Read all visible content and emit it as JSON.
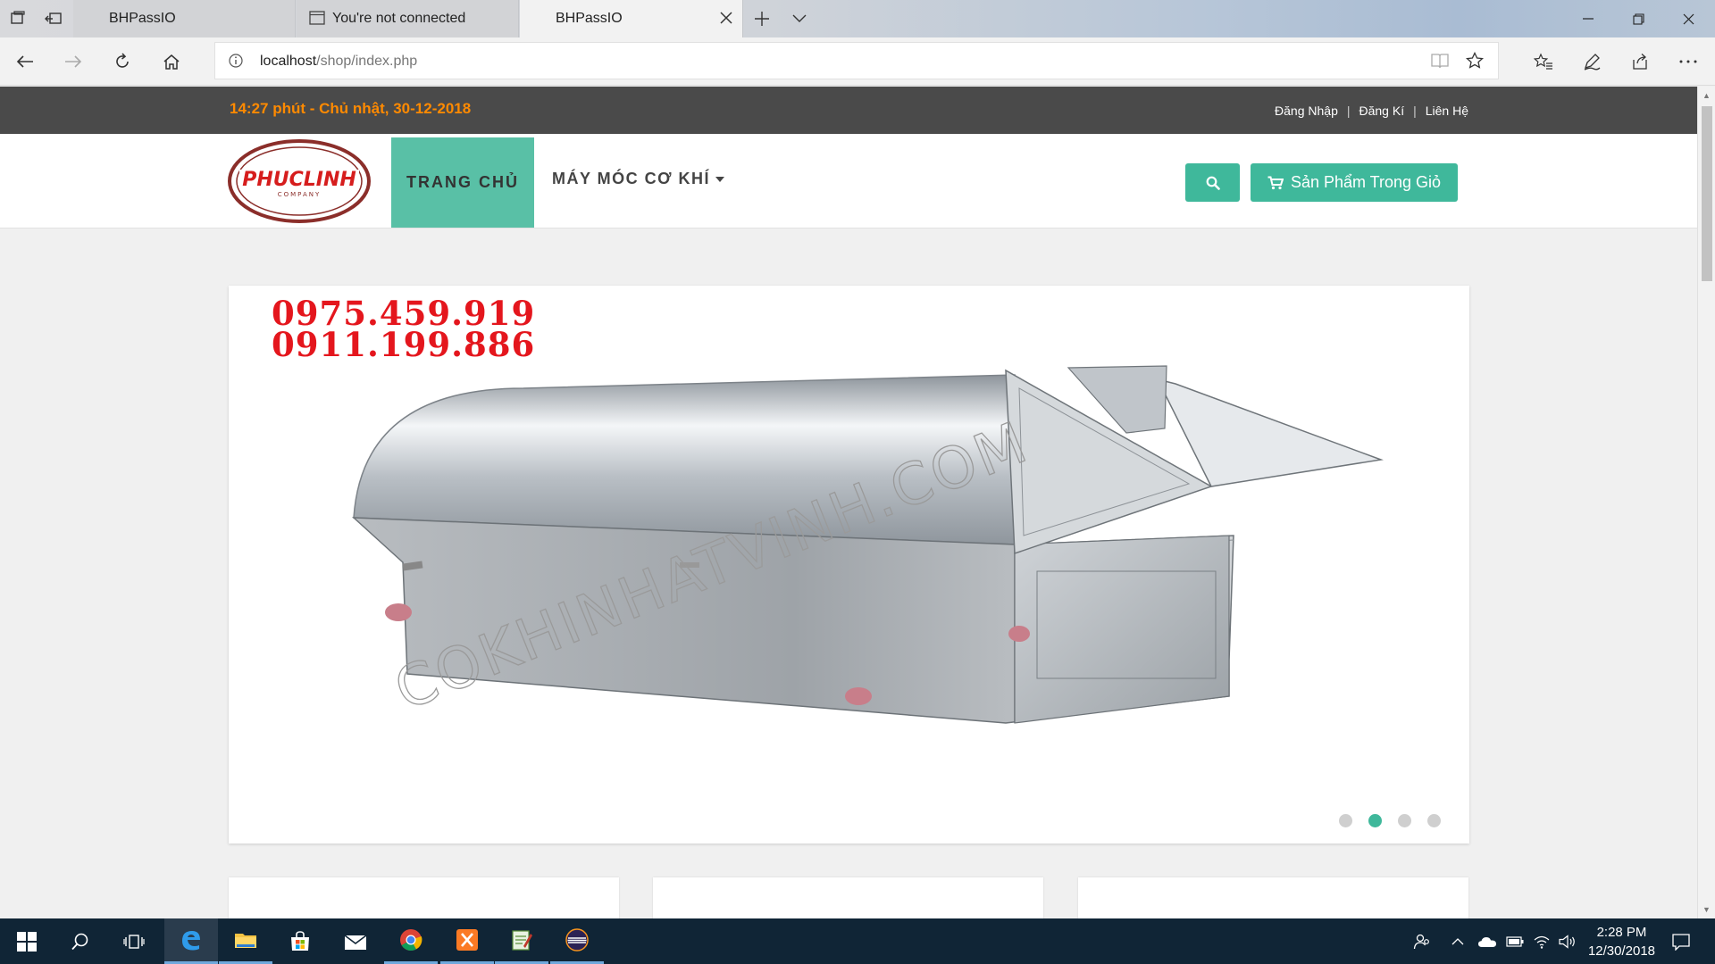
{
  "browser": {
    "tabs": [
      {
        "title": "BHPassIO",
        "active": false
      },
      {
        "title": "You're not connected",
        "active": false
      },
      {
        "title": "BHPassIO",
        "active": true
      }
    ],
    "url_host": "localhost",
    "url_path": "/shop/index.php"
  },
  "site": {
    "datetime": "14:27 phút - Chủ nhật, 30-12-2018",
    "top_links": [
      "Đăng Nhập",
      "Đăng Kí",
      "Liên Hệ"
    ],
    "top_separator": "|",
    "logo_text": "PHUCLINH",
    "logo_sub": "COMPANY",
    "nav_home": "TRANG CHỦ",
    "nav_machines": "MÁY MÓC CƠ KHÍ",
    "cart_label": "Sản Phẩm Trong Giỏ",
    "slider": {
      "phone_1": "0975.459.919",
      "phone_2": "0911.199.886",
      "watermark": "COKHINHATVINH.COM",
      "slide_count": 4,
      "active_slide": 2
    },
    "accent_color": "#3fb89b",
    "datetime_color": "#ff8a00"
  },
  "taskbar": {
    "time": "2:28 PM",
    "date": "12/30/2018",
    "apps": [
      "start-icon",
      "search-icon",
      "task-view-icon",
      "edge-icon",
      "file-explorer-icon",
      "store-icon",
      "mail-icon",
      "chrome-icon",
      "xampp-icon",
      "notepad-icon",
      "eclipse-icon"
    ]
  }
}
